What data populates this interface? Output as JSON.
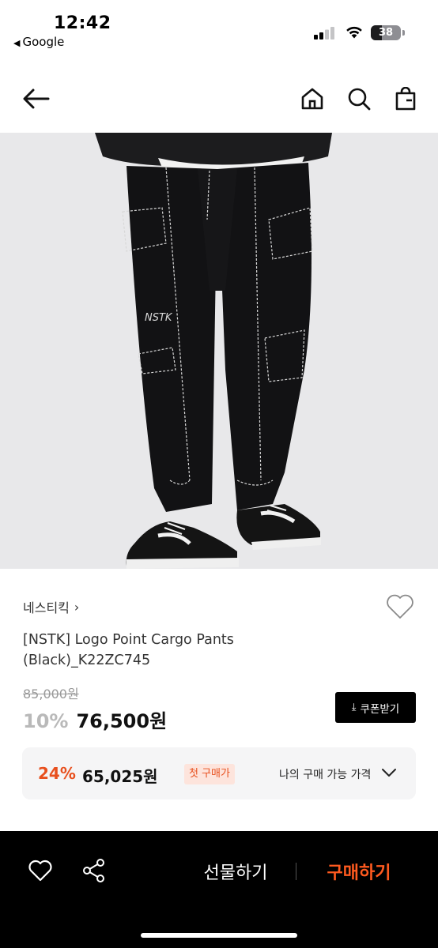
{
  "status": {
    "time": "12:42",
    "back_app": "Google",
    "battery": "38",
    "battery_level": 0.38
  },
  "nav": {
    "back_icon": "arrow-left-icon",
    "home_icon": "home-icon",
    "search_icon": "search-icon",
    "bag_icon": "shopping-bag-icon"
  },
  "product": {
    "brand": "네스티킥",
    "brand_chevron": "›",
    "title": "[NSTK] Logo Point Cargo Pants (Black)_K22ZC745",
    "original_price": "85,000원",
    "discount_rate": "10%",
    "sale_price": "76,500원",
    "coupon_label": "쿠폰받기",
    "image_logo_text": "NSTK"
  },
  "member_price": {
    "rate": "24%",
    "price": "65,025원",
    "badge": "첫 구매가",
    "label": "나의 구매 가능 가격"
  },
  "bottom_bar": {
    "gift_label": "선물하기",
    "buy_label": "구매하기"
  },
  "colors": {
    "accent": "#ff5a1f",
    "member_accent": "#e8501e",
    "badge_bg": "#fde4dc",
    "bar_bg": "#000000",
    "image_bg": "#e8e8ea"
  }
}
